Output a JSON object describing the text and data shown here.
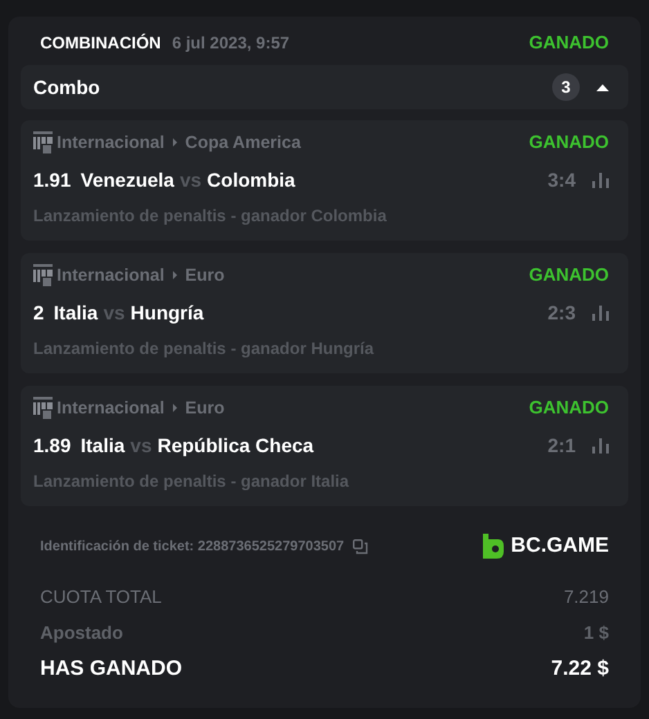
{
  "header": {
    "title": "COMBINACIÓN",
    "date": "6 jul 2023, 9:57",
    "status": "GANADO"
  },
  "combo": {
    "label": "Combo",
    "count": "3",
    "expanded": true
  },
  "bets": [
    {
      "category": "Internacional",
      "league": "Copa America",
      "status": "GANADO",
      "odds": "1.91",
      "home": "Venezuela",
      "vs": "vs",
      "away": "Colombia",
      "score": "3:4",
      "market": "Lanzamiento de penaltis - ganador Colombia"
    },
    {
      "category": "Internacional",
      "league": "Euro",
      "status": "GANADO",
      "odds": "2",
      "home": "Italia",
      "vs": "vs",
      "away": "Hungría",
      "score": "2:3",
      "market": "Lanzamiento de penaltis - ganador Hungría"
    },
    {
      "category": "Internacional",
      "league": "Euro",
      "status": "GANADO",
      "odds": "1.89",
      "home": "Italia",
      "vs": "vs",
      "away": "República Checa",
      "score": "2:1",
      "market": "Lanzamiento de penaltis - ganador Italia"
    }
  ],
  "ticket": {
    "label": "Identificación de ticket: 2288736525279703507",
    "brand": "BC.GAME"
  },
  "summary": [
    {
      "kind": "muted",
      "label": "CUOTA TOTAL",
      "value": "7.219"
    },
    {
      "kind": "muted-bold",
      "label": "Apostado",
      "value": "1 $"
    },
    {
      "kind": "total",
      "label": "HAS GANADO",
      "value": "7.22 $"
    }
  ]
}
